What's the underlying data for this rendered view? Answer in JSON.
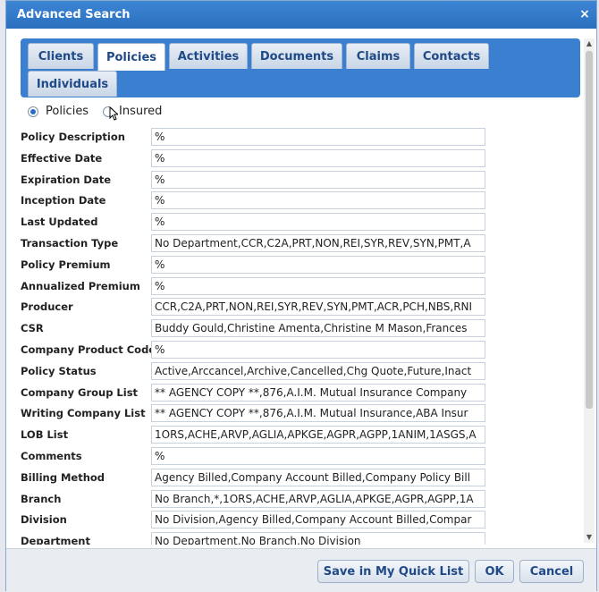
{
  "dialog": {
    "title": "Advanced Search",
    "close_glyph": "×"
  },
  "tabs": [
    "Clients",
    "Policies",
    "Activities",
    "Documents",
    "Claims",
    "Contacts",
    "Individuals"
  ],
  "active_tab": "Policies",
  "radio": {
    "policies_label": "Policies",
    "insured_label": "Insured",
    "selected": "Policies"
  },
  "fields": [
    {
      "label": "Policy Description",
      "value": "%"
    },
    {
      "label": "Effective Date",
      "value": "%"
    },
    {
      "label": "Expiration Date",
      "value": "%"
    },
    {
      "label": "Inception Date",
      "value": "%"
    },
    {
      "label": "Last Updated",
      "value": "%"
    },
    {
      "label": "Transaction Type",
      "value": "No Department,CCR,C2A,PRT,NON,REI,SYR,REV,SYN,PMT,A"
    },
    {
      "label": "Policy Premium",
      "value": "%"
    },
    {
      "label": "Annualized Premium",
      "value": "%"
    },
    {
      "label": "Producer",
      "value": "CCR,C2A,PRT,NON,REI,SYR,REV,SYN,PMT,ACR,PCH,NBS,RNI"
    },
    {
      "label": "CSR",
      "value": "Buddy Gould,Christine Amenta,Christine M Mason,Frances"
    },
    {
      "label": "Company Product Code",
      "value": "%"
    },
    {
      "label": "Policy Status",
      "value": "Active,Arccancel,Archive,Cancelled,Chg Quote,Future,Inact"
    },
    {
      "label": "Company Group List",
      "value": "** AGENCY COPY **,876,A.I.M. Mutual Insurance Company"
    },
    {
      "label": "Writing Company List",
      "value": "** AGENCY COPY **,876,A.I.M. Mutual Insurance,ABA Insur"
    },
    {
      "label": "LOB List",
      "value": "1ORS,ACHE,ARVP,AGLIA,APKGE,AGPR,AGPP,1ANIM,1ASGS,A"
    },
    {
      "label": "Comments",
      "value": "%"
    },
    {
      "label": "Billing Method",
      "value": "Agency Billed,Company Account Billed,Company Policy Bill"
    },
    {
      "label": "Branch",
      "value": "No Branch,*,1ORS,ACHE,ARVP,AGLIA,APKGE,AGPR,AGPP,1A"
    },
    {
      "label": "Division",
      "value": "No Division,Agency Billed,Company Account Billed,Compar"
    },
    {
      "label": "Department",
      "value": "No Department,No Branch,No Division"
    }
  ],
  "buttons": {
    "save_quick_list": "Save in My Quick List",
    "ok": "OK",
    "cancel": "Cancel"
  },
  "scroll": {
    "up_glyph": "▲",
    "down_glyph": "▼"
  },
  "colors": {
    "titlebar": "#2a6fbf",
    "tabstrip": "#3a7fd0",
    "button_text": "#1f4a87"
  }
}
